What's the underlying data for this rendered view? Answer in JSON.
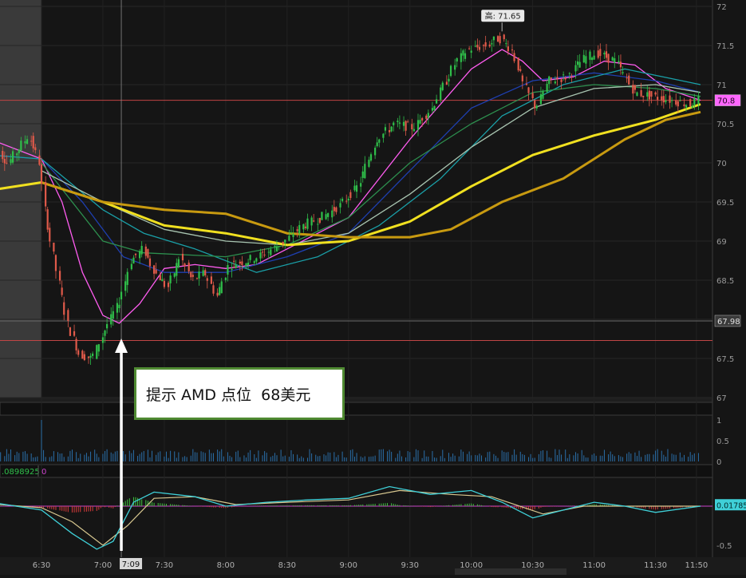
{
  "chart_data": [
    {
      "type": "candlestick",
      "symbol": "AMD",
      "ylim": [
        67,
        72
      ],
      "yticks": [
        "72",
        "71.5",
        "71",
        "70.5",
        "70",
        "69.5",
        "69",
        "68.5",
        "68",
        "67.5",
        "67"
      ],
      "xticks": [
        "6:30",
        "7:00",
        "7:30",
        "8:00",
        "8:30",
        "9:00",
        "9:30",
        "10:00",
        "10:30",
        "11:00",
        "11:30",
        "11:50"
      ],
      "crosshair_time_label": "7:09",
      "high_marker": {
        "label": "高: 71.65",
        "value": 71.65,
        "time": "10:15"
      },
      "price_line_labels": [
        {
          "label": "70.8",
          "value": 70.8,
          "color": "#ff66ff"
        },
        {
          "label": "67.98",
          "value": 67.98,
          "color": "#bbbbbb"
        }
      ],
      "reference_lines": [
        70.8,
        67.98,
        67.73
      ],
      "price_path": [
        {
          "t": "6:05",
          "p": 70.3
        },
        {
          "t": "6:15",
          "p": 70.0
        },
        {
          "t": "6:25",
          "p": 70.35
        },
        {
          "t": "6:30",
          "p": 70.05
        },
        {
          "t": "6:33",
          "p": 69.4
        },
        {
          "t": "6:38",
          "p": 68.7
        },
        {
          "t": "6:44",
          "p": 67.95
        },
        {
          "t": "6:50",
          "p": 67.55
        },
        {
          "t": "6:56",
          "p": 67.5
        },
        {
          "t": "7:03",
          "p": 67.9
        },
        {
          "t": "7:09",
          "p": 68.2
        },
        {
          "t": "7:15",
          "p": 68.75
        },
        {
          "t": "7:21",
          "p": 68.9
        },
        {
          "t": "7:27",
          "p": 68.6
        },
        {
          "t": "7:33",
          "p": 68.4
        },
        {
          "t": "7:39",
          "p": 68.8
        },
        {
          "t": "7:45",
          "p": 68.5
        },
        {
          "t": "7:51",
          "p": 68.6
        },
        {
          "t": "7:57",
          "p": 68.3
        },
        {
          "t": "8:03",
          "p": 68.7
        },
        {
          "t": "8:12",
          "p": 68.75
        },
        {
          "t": "8:21",
          "p": 68.85
        },
        {
          "t": "8:30",
          "p": 69.0
        },
        {
          "t": "8:39",
          "p": 69.2
        },
        {
          "t": "8:48",
          "p": 69.3
        },
        {
          "t": "8:57",
          "p": 69.45
        },
        {
          "t": "9:06",
          "p": 69.7
        },
        {
          "t": "9:15",
          "p": 70.3
        },
        {
          "t": "9:24",
          "p": 70.5
        },
        {
          "t": "9:33",
          "p": 70.45
        },
        {
          "t": "9:42",
          "p": 70.7
        },
        {
          "t": "9:48",
          "p": 71.0
        },
        {
          "t": "9:54",
          "p": 71.3
        },
        {
          "t": "10:00",
          "p": 71.45
        },
        {
          "t": "10:09",
          "p": 71.5
        },
        {
          "t": "10:15",
          "p": 71.6
        },
        {
          "t": "10:21",
          "p": 71.45
        },
        {
          "t": "10:27",
          "p": 71.0
        },
        {
          "t": "10:33",
          "p": 70.7
        },
        {
          "t": "10:39",
          "p": 71.05
        },
        {
          "t": "10:48",
          "p": 71.1
        },
        {
          "t": "10:57",
          "p": 71.35
        },
        {
          "t": "11:03",
          "p": 71.4
        },
        {
          "t": "11:12",
          "p": 71.3
        },
        {
          "t": "11:21",
          "p": 70.9
        },
        {
          "t": "11:30",
          "p": 70.85
        },
        {
          "t": "11:39",
          "p": 70.8
        },
        {
          "t": "11:48",
          "p": 70.75
        },
        {
          "t": "11:52",
          "p": 70.8
        }
      ],
      "moving_averages": [
        {
          "color": "#ff5cf0",
          "values": [
            {
              "t": "6:05",
              "p": 70.3
            },
            {
              "t": "6:30",
              "p": 70.05
            },
            {
              "t": "6:40",
              "p": 69.5
            },
            {
              "t": "6:50",
              "p": 68.6
            },
            {
              "t": "7:00",
              "p": 68.05
            },
            {
              "t": "7:08",
              "p": 67.95
            },
            {
              "t": "7:18",
              "p": 68.2
            },
            {
              "t": "7:30",
              "p": 68.65
            },
            {
              "t": "7:45",
              "p": 68.7
            },
            {
              "t": "8:00",
              "p": 68.65
            },
            {
              "t": "8:15",
              "p": 68.7
            },
            {
              "t": "8:30",
              "p": 68.9
            },
            {
              "t": "8:45",
              "p": 69.1
            },
            {
              "t": "9:00",
              "p": 69.3
            },
            {
              "t": "9:15",
              "p": 69.8
            },
            {
              "t": "9:30",
              "p": 70.3
            },
            {
              "t": "9:45",
              "p": 70.75
            },
            {
              "t": "10:00",
              "p": 71.2
            },
            {
              "t": "10:15",
              "p": 71.45
            },
            {
              "t": "10:25",
              "p": 71.3
            },
            {
              "t": "10:35",
              "p": 71.05
            },
            {
              "t": "10:50",
              "p": 71.1
            },
            {
              "t": "11:05",
              "p": 71.3
            },
            {
              "t": "11:20",
              "p": 71.25
            },
            {
              "t": "11:35",
              "p": 70.95
            },
            {
              "t": "11:52",
              "p": 70.8
            }
          ]
        },
        {
          "color": "#1e3fb0",
          "values": [
            {
              "t": "6:05",
              "p": 70.1
            },
            {
              "t": "6:30",
              "p": 70.05
            },
            {
              "t": "6:50",
              "p": 69.5
            },
            {
              "t": "7:10",
              "p": 68.8
            },
            {
              "t": "7:30",
              "p": 68.6
            },
            {
              "t": "8:00",
              "p": 68.6
            },
            {
              "t": "8:30",
              "p": 68.8
            },
            {
              "t": "9:00",
              "p": 69.1
            },
            {
              "t": "9:30",
              "p": 69.9
            },
            {
              "t": "10:00",
              "p": 70.7
            },
            {
              "t": "10:30",
              "p": 71.05
            },
            {
              "t": "11:00",
              "p": 71.15
            },
            {
              "t": "11:30",
              "p": 71.05
            },
            {
              "t": "11:52",
              "p": 70.9
            }
          ]
        },
        {
          "color": "#1aa0a8",
          "values": [
            {
              "t": "6:05",
              "p": 70.1
            },
            {
              "t": "6:30",
              "p": 70.05
            },
            {
              "t": "7:00",
              "p": 69.4
            },
            {
              "t": "7:20",
              "p": 69.1
            },
            {
              "t": "7:45",
              "p": 68.9
            },
            {
              "t": "8:15",
              "p": 68.6
            },
            {
              "t": "8:45",
              "p": 68.8
            },
            {
              "t": "9:15",
              "p": 69.2
            },
            {
              "t": "9:45",
              "p": 69.8
            },
            {
              "t": "10:15",
              "p": 70.6
            },
            {
              "t": "10:45",
              "p": 71.0
            },
            {
              "t": "11:15",
              "p": 71.2
            },
            {
              "t": "11:52",
              "p": 71.0
            }
          ]
        },
        {
          "color": "#2d8f4e",
          "values": [
            {
              "t": "6:30",
              "p": 70.0
            },
            {
              "t": "7:00",
              "p": 69.0
            },
            {
              "t": "7:20",
              "p": 68.85
            },
            {
              "t": "8:00",
              "p": 68.8
            },
            {
              "t": "8:30",
              "p": 68.95
            },
            {
              "t": "9:00",
              "p": 69.3
            },
            {
              "t": "9:30",
              "p": 70.0
            },
            {
              "t": "10:00",
              "p": 70.5
            },
            {
              "t": "10:30",
              "p": 70.9
            },
            {
              "t": "11:00",
              "p": 71.0
            },
            {
              "t": "11:30",
              "p": 70.95
            },
            {
              "t": "11:52",
              "p": 70.85
            }
          ]
        },
        {
          "color": "#a8c4b0",
          "values": [
            {
              "t": "6:30",
              "p": 69.9
            },
            {
              "t": "7:00",
              "p": 69.5
            },
            {
              "t": "7:30",
              "p": 69.15
            },
            {
              "t": "8:00",
              "p": 69.0
            },
            {
              "t": "8:30",
              "p": 68.95
            },
            {
              "t": "9:00",
              "p": 69.1
            },
            {
              "t": "9:30",
              "p": 69.6
            },
            {
              "t": "10:00",
              "p": 70.2
            },
            {
              "t": "10:30",
              "p": 70.7
            },
            {
              "t": "11:00",
              "p": 70.95
            },
            {
              "t": "11:30",
              "p": 71.0
            },
            {
              "t": "11:52",
              "p": 70.9
            }
          ]
        },
        {
          "color": "#f0e020",
          "width": 3,
          "values": [
            {
              "t": "6:05",
              "p": 69.65
            },
            {
              "t": "6:30",
              "p": 69.75
            },
            {
              "t": "7:00",
              "p": 69.5
            },
            {
              "t": "7:30",
              "p": 69.2
            },
            {
              "t": "8:00",
              "p": 69.1
            },
            {
              "t": "8:30",
              "p": 68.95
            },
            {
              "t": "9:00",
              "p": 69.0
            },
            {
              "t": "9:30",
              "p": 69.25
            },
            {
              "t": "10:00",
              "p": 69.7
            },
            {
              "t": "10:30",
              "p": 70.1
            },
            {
              "t": "11:00",
              "p": 70.35
            },
            {
              "t": "11:30",
              "p": 70.55
            },
            {
              "t": "11:52",
              "p": 70.75
            }
          ]
        },
        {
          "color": "#c89a10",
          "width": 3,
          "values": [
            {
              "t": "6:30",
              "p": 69.75
            },
            {
              "t": "7:00",
              "p": 69.5
            },
            {
              "t": "7:30",
              "p": 69.4
            },
            {
              "t": "8:00",
              "p": 69.35
            },
            {
              "t": "8:30",
              "p": 69.1
            },
            {
              "t": "9:00",
              "p": 69.05
            },
            {
              "t": "9:30",
              "p": 69.05
            },
            {
              "t": "9:50",
              "p": 69.15
            },
            {
              "t": "10:15",
              "p": 69.5
            },
            {
              "t": "10:45",
              "p": 69.8
            },
            {
              "t": "11:15",
              "p": 70.3
            },
            {
              "t": "11:35",
              "p": 70.55
            },
            {
              "t": "11:52",
              "p": 70.65
            }
          ]
        }
      ]
    },
    {
      "type": "bar",
      "panel": "volume",
      "yticks": [
        "1",
        "0.5",
        "0"
      ],
      "ylim": [
        0,
        1.2
      ]
    },
    {
      "type": "line",
      "panel": "oscillator",
      "header_values": [
        ".0898925",
        "0"
      ],
      "yticks": [
        "-0.5"
      ],
      "current_value_label": "0.01785",
      "fast_line": [
        {
          "t": "6:05",
          "v": 0.05
        },
        {
          "t": "6:30",
          "v": -0.05
        },
        {
          "t": "6:45",
          "v": -0.35
        },
        {
          "t": "6:57",
          "v": -0.55
        },
        {
          "t": "7:05",
          "v": -0.45
        },
        {
          "t": "7:15",
          "v": 0.05
        },
        {
          "t": "7:25",
          "v": 0.18
        },
        {
          "t": "7:45",
          "v": 0.12
        },
        {
          "t": "8:00",
          "v": 0.0
        },
        {
          "t": "8:20",
          "v": 0.05
        },
        {
          "t": "8:40",
          "v": 0.08
        },
        {
          "t": "9:00",
          "v": 0.1
        },
        {
          "t": "9:20",
          "v": 0.25
        },
        {
          "t": "9:40",
          "v": 0.15
        },
        {
          "t": "10:00",
          "v": 0.2
        },
        {
          "t": "10:15",
          "v": 0.05
        },
        {
          "t": "10:30",
          "v": -0.15
        },
        {
          "t": "10:45",
          "v": -0.05
        },
        {
          "t": "11:00",
          "v": 0.05
        },
        {
          "t": "11:15",
          "v": 0.0
        },
        {
          "t": "11:30",
          "v": -0.08
        },
        {
          "t": "11:52",
          "v": 0.0
        }
      ],
      "slow_line": [
        {
          "t": "6:05",
          "v": 0.03
        },
        {
          "t": "6:30",
          "v": -0.02
        },
        {
          "t": "6:45",
          "v": -0.2
        },
        {
          "t": "7:00",
          "v": -0.5
        },
        {
          "t": "7:12",
          "v": -0.25
        },
        {
          "t": "7:25",
          "v": 0.1
        },
        {
          "t": "7:45",
          "v": 0.12
        },
        {
          "t": "8:05",
          "v": 0.02
        },
        {
          "t": "8:30",
          "v": 0.05
        },
        {
          "t": "9:00",
          "v": 0.08
        },
        {
          "t": "9:25",
          "v": 0.2
        },
        {
          "t": "9:50",
          "v": 0.15
        },
        {
          "t": "10:10",
          "v": 0.12
        },
        {
          "t": "10:35",
          "v": -0.1
        },
        {
          "t": "10:55",
          "v": 0.0
        },
        {
          "t": "11:20",
          "v": 0.0
        },
        {
          "t": "11:52",
          "v": 0.0
        }
      ],
      "zero_line": 0
    }
  ],
  "annotation": {
    "text": "提示 AMD 点位  68美元"
  }
}
